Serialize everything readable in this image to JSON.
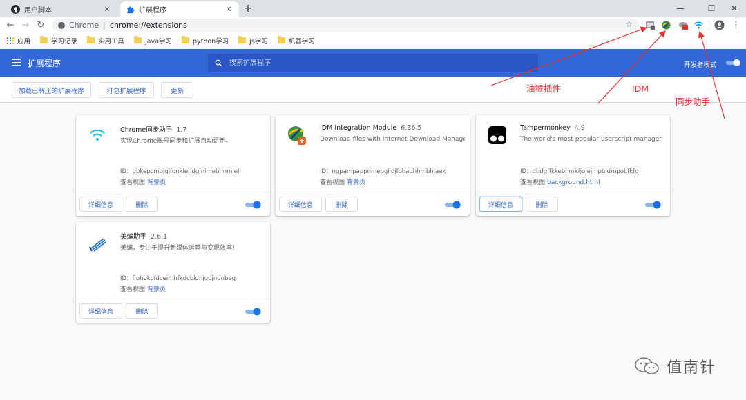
{
  "browser": {
    "tabs": [
      {
        "label": "用户脚本",
        "icon": "github-icon"
      },
      {
        "label": "扩展程序",
        "icon": "puzzle-icon"
      }
    ],
    "new_tab": "+",
    "window_controls": {
      "minimize": "—",
      "maximize": "☐",
      "close": "✕"
    },
    "address": {
      "scheme": "Chrome",
      "separator": "|",
      "url": "chrome://extensions"
    },
    "bookmarks": {
      "apps_label": "应用",
      "items": [
        "学习记录",
        "实用工具",
        "java学习",
        "python学习",
        "js学习",
        "机器学习"
      ]
    }
  },
  "extensions_page": {
    "title": "扩展程序",
    "search_placeholder": "搜索扩展程序",
    "dev_mode_label": "开发者模式",
    "dev_mode_on": true,
    "actions": {
      "load_unpacked": "加载已解压的扩展程序",
      "pack": "打包扩展程序",
      "update": "更新"
    },
    "cards": [
      {
        "name": "Chrome同步助手",
        "version": "1.7",
        "description": "实现Chrome账号同步和扩展自动更新。",
        "id_text": "ID：gbkepcmpjglfonklehdgjnimebhnmlel",
        "views_label": "查看视图",
        "view_link": "背景页",
        "details": "详细信息",
        "remove": "删除",
        "enabled": true
      },
      {
        "name": "IDM Integration Module",
        "version": "6.36.5",
        "description": "Download files with Internet Download Manager",
        "id_text": "ID：ngpampappnmepgilojfohadhhmbhlaek",
        "views_label": "查看视图",
        "view_link": "背景页",
        "details": "详细信息",
        "remove": "删除",
        "enabled": true
      },
      {
        "name": "Tampermonkey",
        "version": "4.9",
        "description": "The world's most popular userscript manager",
        "id_text": "ID：dhdgffkkebhmkfjojejmpbldmpobfkfo",
        "views_label": "查看视图",
        "view_link": "background.html",
        "details": "详细信息",
        "remove": "删除",
        "enabled": true
      },
      {
        "name": "美编助手",
        "version": "2.6.1",
        "description": "美编，专注于提升新媒体运营与变现效率！",
        "id_text": "ID：fjohbkcfdceimhfkdcbldnjgdjndnbeg",
        "views_label": "查看视图",
        "view_link": "背景页",
        "details": "详细信息",
        "remove": "删除",
        "enabled": true
      }
    ]
  },
  "annotations": {
    "tampermonkey": "油猴插件",
    "idm": "IDM",
    "sync": "同步助手",
    "color": "#e8322f"
  },
  "watermark": "值南针",
  "colors": {
    "accent": "#3367d6",
    "toggle": "#1a73e8"
  }
}
